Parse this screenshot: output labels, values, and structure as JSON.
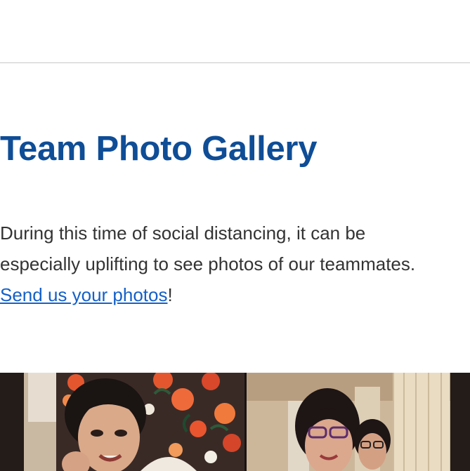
{
  "section": {
    "title": "Team Photo Gallery",
    "intro_text": "During this time of social distancing, it can be especially uplifting to see photos of our teammates. ",
    "link_text": "Send us your photos",
    "after_link": "!"
  },
  "colors": {
    "title": "#0f4d96",
    "body_text": "#333333",
    "link": "#1560c8",
    "divider": "#c8c8c8"
  },
  "photo": {
    "subject": "video-call-team-photo"
  }
}
